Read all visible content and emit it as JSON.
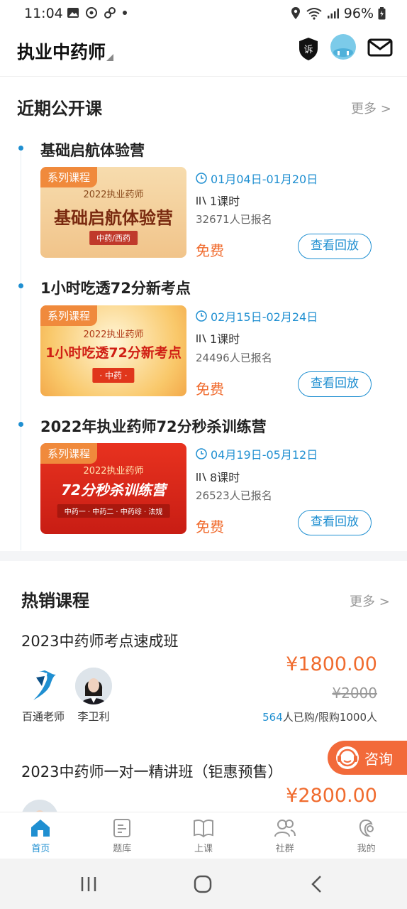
{
  "status": {
    "time": "11:04",
    "battery": "96%"
  },
  "header": {
    "title": "执业中药师"
  },
  "open_courses": {
    "title": "近期公开课",
    "more": "更多 >",
    "items": [
      {
        "name": "基础启航体验营",
        "tag": "系列课程",
        "thumb_sub": "2022执业药师",
        "thumb_big": "基础启航体验营",
        "thumb_pill": "中药/西药",
        "date": "01月04日-01月20日",
        "lessons": "1课时",
        "enrolled": "32671人已报名",
        "price": "免费",
        "button": "查看回放"
      },
      {
        "name": "1小时吃透72分新考点",
        "tag": "系列课程",
        "thumb_sub": "2022执业药师",
        "thumb_big": "1小时吃透72分新考点",
        "thumb_pill": "· 中药 ·",
        "date": "02月15日-02月24日",
        "lessons": "1课时",
        "enrolled": "24496人已报名",
        "price": "免费",
        "button": "查看回放"
      },
      {
        "name": "2022年执业药师72分秒杀训练营",
        "tag": "系列课程",
        "thumb_sub": "2022执业药师",
        "thumb_big": "72分秒杀训练营",
        "thumb_pill": "中药一 · 中药二 · 中药综 · 法规",
        "date": "04月19日-05月12日",
        "lessons": "8课时",
        "enrolled": "26523人已报名",
        "price": "免费",
        "button": "查看回放"
      }
    ]
  },
  "hot_courses": {
    "title": "热销课程",
    "more": "更多 >",
    "items": [
      {
        "name": "2023中药师考点速成班",
        "price": "¥1800.00",
        "old_price": "¥2000",
        "sold_num": "564",
        "sold_suffix": "人已购/限购1000人",
        "teachers": [
          "百通老师",
          "李卫利"
        ]
      },
      {
        "name": "2023中药师一对一精讲班（钜惠预售）",
        "price": "¥2800.00"
      }
    ]
  },
  "consult": {
    "label": "咨询"
  },
  "tabs": [
    "首页",
    "题库",
    "上课",
    "社群",
    "我的"
  ],
  "colors": {
    "accent": "#1f8fd1",
    "price": "#f06b2e"
  }
}
